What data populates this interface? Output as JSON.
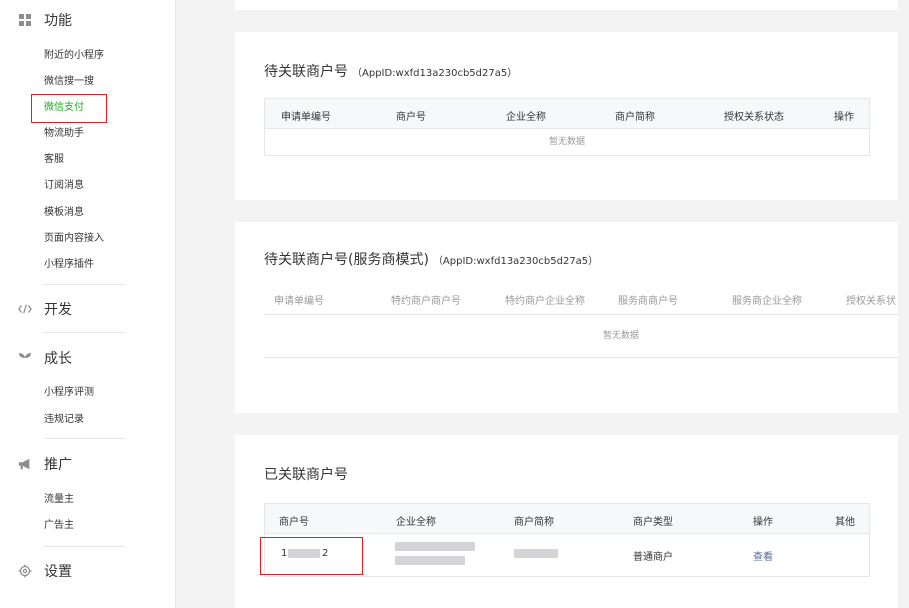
{
  "sidebar": {
    "categories": [
      {
        "label": "功能",
        "icon": "grid-icon"
      },
      {
        "label": "开发",
        "icon": "code-icon"
      },
      {
        "label": "成长",
        "icon": "sprout-icon"
      },
      {
        "label": "推广",
        "icon": "megaphone-icon"
      },
      {
        "label": "设置",
        "icon": "gear-icon"
      }
    ],
    "function_items": [
      "附近的小程序",
      "微信搜一搜",
      "微信支付",
      "物流助手",
      "客服",
      "订阅消息",
      "模板消息",
      "页面内容接入",
      "小程序插件"
    ],
    "growth_items": [
      "小程序评测",
      "违规记录"
    ],
    "promo_items": [
      "流量主",
      "广告主"
    ],
    "active_item": "微信支付"
  },
  "pending": {
    "title": "待关联商户号",
    "appid": "（AppID:wxfd13a230cb5d27a5）",
    "columns": [
      "申请单编号",
      "商户号",
      "企业全称",
      "商户简称",
      "授权关系状态",
      "操作"
    ],
    "empty_text": "暂无数据"
  },
  "pending_service": {
    "title": "待关联商户号(服务商模式)",
    "appid": "（AppID:wxfd13a230cb5d27a5）",
    "columns": [
      "申请单编号",
      "特约商户商户号",
      "特约商户企业全称",
      "服务商商户号",
      "服务商企业全称",
      "授权关系状"
    ],
    "empty_text": "暂无数据"
  },
  "linked": {
    "title": "已关联商户号",
    "columns": [
      "商户号",
      "企业全称",
      "商户简称",
      "商户类型",
      "操作",
      "其他"
    ],
    "row": {
      "merchant_id_prefix": "1",
      "merchant_id_suffix": "2",
      "type": "普通商户",
      "action": "查看"
    }
  }
}
